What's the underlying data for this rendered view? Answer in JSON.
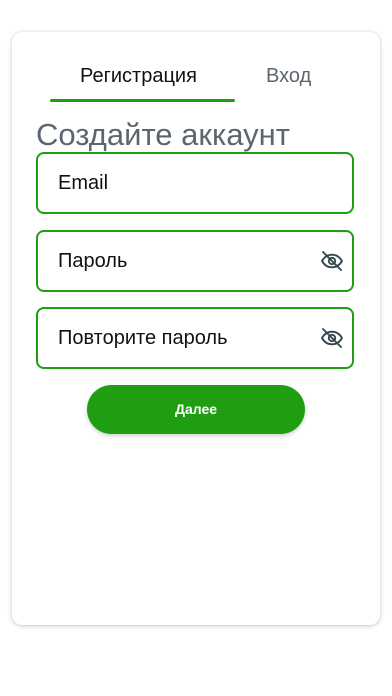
{
  "tabs": {
    "register_label": "Регистрация",
    "login_label": "Вход",
    "active": "register"
  },
  "form": {
    "title": "Создайте аккаунт",
    "email_placeholder": "Email",
    "password_placeholder": "Пароль",
    "repeat_password_placeholder": "Повторите пароль",
    "password_toggle_icon": "eye-off-icon",
    "submit_label": "Далее"
  },
  "colors": {
    "accent": "#1f9e12",
    "muted_text": "#5b6670",
    "text": "#111111"
  }
}
